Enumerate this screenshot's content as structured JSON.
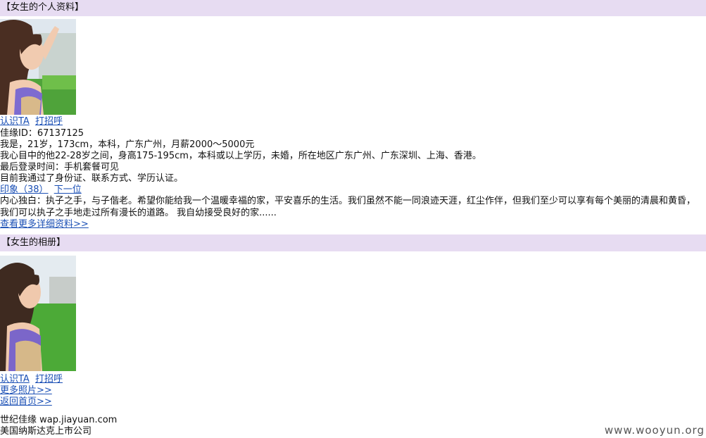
{
  "profile_section": {
    "header": "【女生的个人资料】",
    "photo_icon": "portrait-photo",
    "actions": {
      "know_label": "认识TA",
      "greet_label": "打招呼"
    },
    "id_line": "佳缘ID：67137125",
    "intro": "我是，21岁，173cm，本科，广东广州，月薪2000～5000元",
    "ideal_partner": "我心目中的他22-28岁之间，身高175-195cm，本科或以上学历，未婚，所在地区广东广州、广东深圳、上海、香港。",
    "last_login": "最后登录时间：手机套餐可见",
    "verification": "目前我通过了身份证、联系方式、学历认证。",
    "impressions_label": "印象（38）",
    "next_label": "下一位",
    "monologue": "内心独白：执子之手，与子偕老。希望你能给我一个温暖幸福的家，平安喜乐的生活。我们虽然不能一同浪迹天涯，红尘作伴，但我们至少可以享有每个美丽的清晨和黄昏，我们可以执子之手地走过所有漫长的道路。 我自幼接受良好的家......",
    "more_details_label": "查看更多详细资料>>"
  },
  "album_section": {
    "header": "【女生的相册】",
    "photo_icon": "portrait-photo",
    "actions": {
      "know_label": "认识TA",
      "greet_label": "打招呼"
    },
    "more_photos_label": "更多照片>>",
    "home_label": "返回首页>>"
  },
  "footer": {
    "site": "世纪佳缘 wap.jiayuan.com",
    "company": "美国纳斯达克上市公司"
  },
  "watermark": "www.wooyun.org",
  "colors": {
    "header_bg": "#e7dcf2",
    "link": "#1a4fb5",
    "text": "#111111"
  }
}
